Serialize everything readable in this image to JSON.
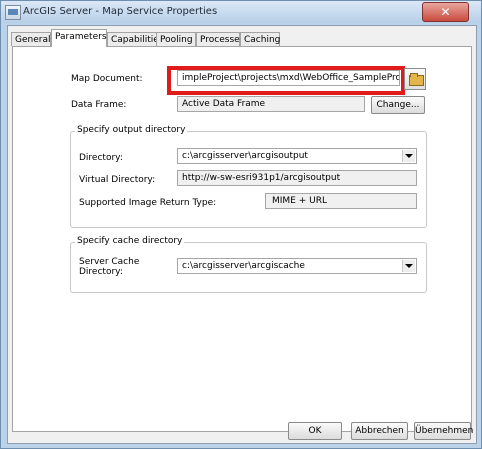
{
  "window": {
    "title": "ArcGIS Server - Map Service Properties",
    "close_label": "✕"
  },
  "tabs": [
    {
      "label": "General"
    },
    {
      "label": "Parameters"
    },
    {
      "label": "Capabilities"
    },
    {
      "label": "Pooling"
    },
    {
      "label": "Processes"
    },
    {
      "label": "Caching"
    }
  ],
  "map": {
    "document_label": "Map Document:",
    "document_value": "impleProject\\projects\\mxd\\WebOffice_SampleProject.msd",
    "frame_label": "Data Frame:",
    "frame_value": "Active Data Frame",
    "change_label": "Change..."
  },
  "output": {
    "group_title": "Specify output directory",
    "directory_label": "Directory:",
    "directory_value": "c:\\arcgisserver\\arcgisoutput",
    "virtual_label": "Virtual Directory:",
    "virtual_value": "http://w-sw-esri931p1/arcgisoutput",
    "image_label": "Supported Image Return Type:",
    "image_value": "MIME + URL"
  },
  "cache": {
    "group_title": "Specify cache directory",
    "server_label_1": "Server Cache",
    "server_label_2": "Directory:",
    "server_value": "c:\\arcgisserver\\arcgiscache"
  },
  "footer": {
    "ok": "OK",
    "cancel": "Abbrechen",
    "apply": "Übernehmen"
  }
}
